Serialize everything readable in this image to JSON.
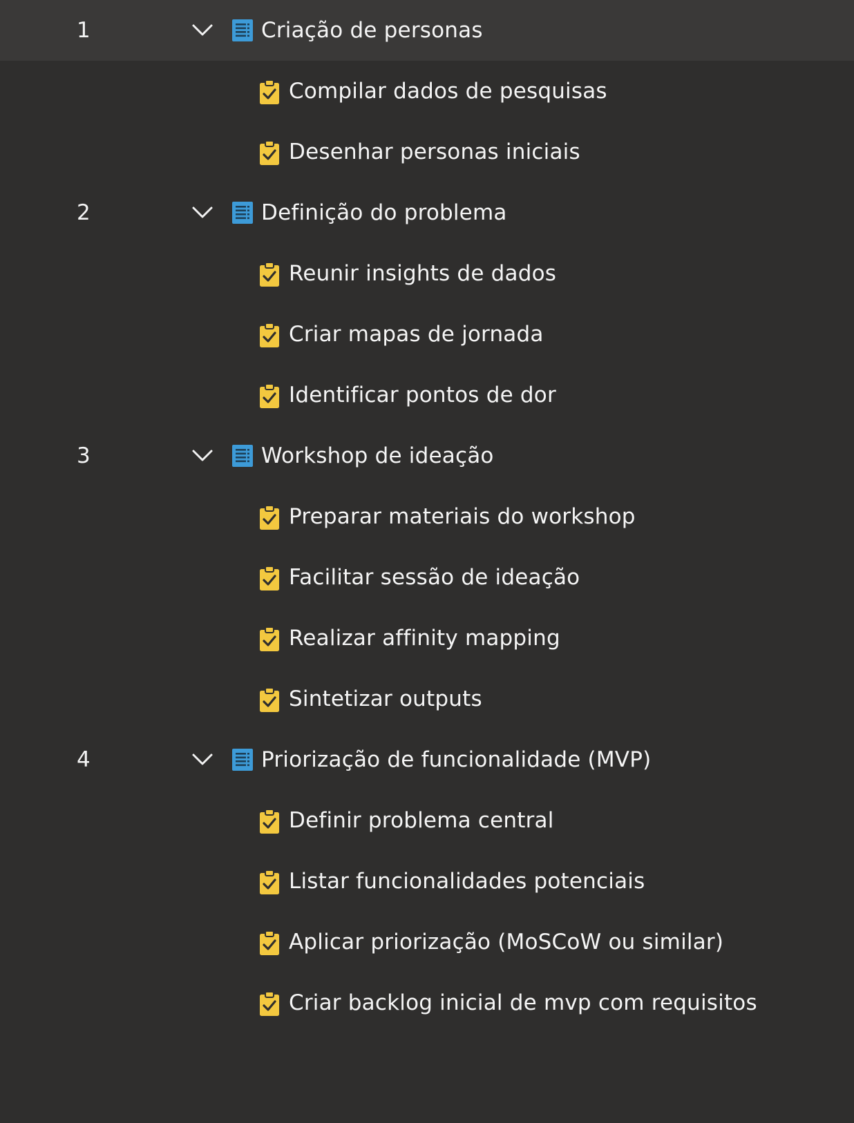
{
  "groups": [
    {
      "number": "1",
      "title": "Criação de personas",
      "selected": true,
      "tasks": [
        "Compilar dados de pesquisas",
        "Desenhar personas iniciais"
      ]
    },
    {
      "number": "2",
      "title": "Definição do problema",
      "selected": false,
      "tasks": [
        "Reunir insights de dados",
        "Criar mapas de jornada",
        "Identificar pontos de dor"
      ]
    },
    {
      "number": "3",
      "title": "Workshop de ideação",
      "selected": false,
      "tasks": [
        "Preparar materiais do workshop",
        "Facilitar sessão de ideação",
        "Realizar affinity mapping",
        "Sintetizar outputs"
      ]
    },
    {
      "number": "4",
      "title": "Priorização de funcionalidade (MVP)",
      "selected": false,
      "tasks": [
        "Definir problema central",
        "Listar funcionalidades potenciais",
        "Aplicar priorização (MoSCoW ou similar)",
        "Criar backlog inicial de mvp com requisitos"
      ]
    }
  ],
  "icons": {
    "group_expand": "chevron-down-icon",
    "group_type": "document-list-icon",
    "task_type": "clipboard-check-icon"
  },
  "colors": {
    "background": "#2f2e2d",
    "selected_row": "#3a3938",
    "document_icon": "#3d9bd8",
    "task_icon": "#f3c83f",
    "text": "#f5f5f5"
  }
}
